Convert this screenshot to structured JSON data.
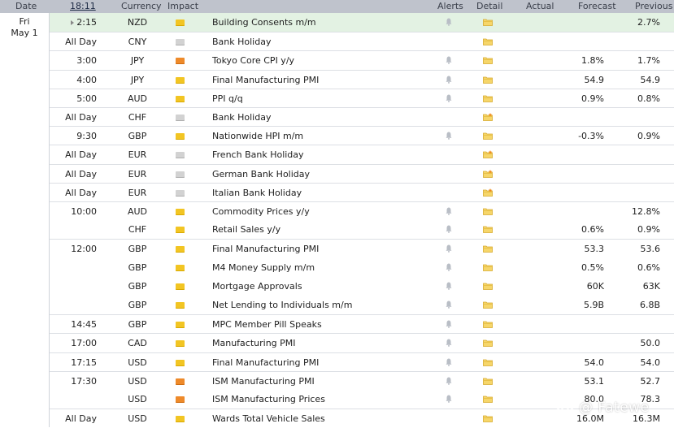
{
  "header": {
    "date": "Date",
    "time": "18:11",
    "currency": "Currency",
    "impact": "Impact",
    "alerts": "Alerts",
    "detail": "Detail",
    "actual": "Actual",
    "forecast": "Forecast",
    "previous": "Previous"
  },
  "date_cell": {
    "day": "Fri",
    "date": "May 1"
  },
  "rows": [
    {
      "time": "2:15",
      "currency": "NZD",
      "impact": "yellow",
      "event": "Building Consents m/m",
      "bell": true,
      "detail": "folder",
      "forecast": "",
      "previous": "2.7%",
      "highlight": true,
      "arrow": true
    },
    {
      "time": "All Day",
      "currency": "CNY",
      "impact": "gray",
      "event": "Bank Holiday",
      "bell": false,
      "detail": "folder",
      "forecast": "",
      "previous": ""
    },
    {
      "time": "3:00",
      "currency": "JPY",
      "impact": "orange",
      "event": "Tokyo Core CPI y/y",
      "bell": true,
      "detail": "folder",
      "forecast": "1.8%",
      "previous": "1.7%"
    },
    {
      "time": "4:00",
      "currency": "JPY",
      "impact": "yellow",
      "event": "Final Manufacturing PMI",
      "bell": true,
      "detail": "folder",
      "forecast": "54.9",
      "previous": "54.9"
    },
    {
      "time": "5:00",
      "currency": "AUD",
      "impact": "yellow",
      "event": "PPI q/q",
      "bell": true,
      "detail": "folder",
      "forecast": "0.9%",
      "previous": "0.8%"
    },
    {
      "time": "All Day",
      "currency": "CHF",
      "impact": "gray",
      "event": "Bank Holiday",
      "bell": false,
      "detail": "folder-star",
      "forecast": "",
      "previous": ""
    },
    {
      "time": "9:30",
      "currency": "GBP",
      "impact": "yellow",
      "event": "Nationwide HPI m/m",
      "bell": true,
      "detail": "folder",
      "forecast": "-0.3%",
      "previous": "0.9%"
    },
    {
      "time": "All Day",
      "currency": "EUR",
      "impact": "gray",
      "event": "French Bank Holiday",
      "bell": false,
      "detail": "folder-star",
      "forecast": "",
      "previous": ""
    },
    {
      "time": "All Day",
      "currency": "EUR",
      "impact": "gray",
      "event": "German Bank Holiday",
      "bell": false,
      "detail": "folder-star",
      "forecast": "",
      "previous": ""
    },
    {
      "time": "All Day",
      "currency": "EUR",
      "impact": "gray",
      "event": "Italian Bank Holiday",
      "bell": false,
      "detail": "folder-star",
      "forecast": "",
      "previous": ""
    },
    {
      "time": "10:00",
      "currency": "AUD",
      "impact": "yellow",
      "event": "Commodity Prices y/y",
      "bell": true,
      "detail": "folder",
      "forecast": "",
      "previous": "12.8%"
    },
    {
      "time": "",
      "currency": "CHF",
      "impact": "yellow",
      "event": "Retail Sales y/y",
      "bell": true,
      "detail": "folder",
      "forecast": "0.6%",
      "previous": "0.9%"
    },
    {
      "time": "12:00",
      "currency": "GBP",
      "impact": "yellow",
      "event": "Final Manufacturing PMI",
      "bell": true,
      "detail": "folder",
      "forecast": "53.3",
      "previous": "53.6"
    },
    {
      "time": "",
      "currency": "GBP",
      "impact": "yellow",
      "event": "M4 Money Supply m/m",
      "bell": true,
      "detail": "folder",
      "forecast": "0.5%",
      "previous": "0.6%"
    },
    {
      "time": "",
      "currency": "GBP",
      "impact": "yellow",
      "event": "Mortgage Approvals",
      "bell": true,
      "detail": "folder",
      "forecast": "60K",
      "previous": "63K"
    },
    {
      "time": "",
      "currency": "GBP",
      "impact": "yellow",
      "event": "Net Lending to Individuals m/m",
      "bell": true,
      "detail": "folder",
      "forecast": "5.9B",
      "previous": "6.8B"
    },
    {
      "time": "14:45",
      "currency": "GBP",
      "impact": "yellow",
      "event": "MPC Member Pill Speaks",
      "bell": true,
      "detail": "folder",
      "forecast": "",
      "previous": ""
    },
    {
      "time": "17:00",
      "currency": "CAD",
      "impact": "yellow",
      "event": "Manufacturing PMI",
      "bell": true,
      "detail": "folder",
      "forecast": "",
      "previous": "50.0"
    },
    {
      "time": "17:15",
      "currency": "USD",
      "impact": "yellow",
      "event": "Final Manufacturing PMI",
      "bell": true,
      "detail": "folder",
      "forecast": "54.0",
      "previous": "54.0"
    },
    {
      "time": "17:30",
      "currency": "USD",
      "impact": "orange",
      "event": "ISM Manufacturing PMI",
      "bell": true,
      "detail": "folder",
      "forecast": "53.1",
      "previous": "52.7"
    },
    {
      "time": "",
      "currency": "USD",
      "impact": "orange",
      "event": "ISM Manufacturing Prices",
      "bell": true,
      "detail": "folder",
      "forecast": "80.0",
      "previous": "78.3"
    },
    {
      "time": "All Day",
      "currency": "USD",
      "impact": "yellow",
      "event": "Wards Total Vehicle Sales",
      "bell": false,
      "detail": "folder",
      "forecast": "16.0M",
      "previous": "16.3M"
    }
  ],
  "watermark": {
    "text": "@ Fatewe",
    "icon": "fatewe-logo-icon"
  }
}
